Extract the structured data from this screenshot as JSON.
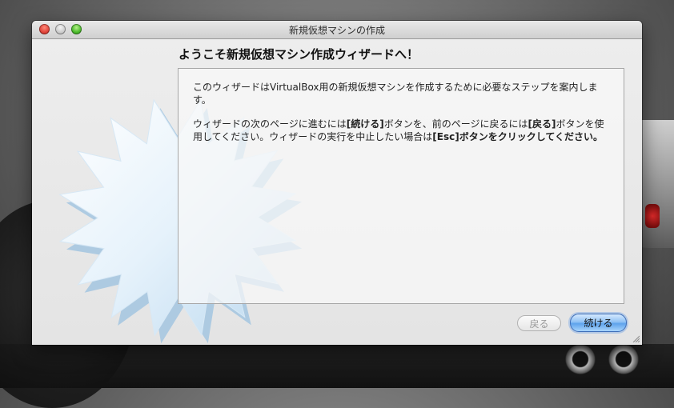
{
  "window": {
    "title": "新規仮想マシンの作成"
  },
  "wizard": {
    "heading": "ようこそ新規仮想マシン作成ウィザードへ！",
    "paragraph1": "このウィザードはVirtualBox用の新規仮想マシンを作成するために必要なステップを案内します。",
    "paragraph2_parts": {
      "a": "ウィザードの次のページに進むには",
      "b": "[続ける]",
      "c": "ボタンを、前のページに戻るには",
      "d": "[戻る]",
      "e": "ボタンを使用してください。ウィザードの実行を中止したい場合は",
      "f": "[Esc]ボタンをクリックしてください。"
    }
  },
  "buttons": {
    "back_label": "戻る",
    "back_enabled": false,
    "next_label": "続ける"
  },
  "colors": {
    "accent": "#5ea3ec",
    "close": "#e0443a",
    "zoom": "#49b92a"
  },
  "icons": {
    "window_controls": [
      "close-icon",
      "minimize-icon",
      "zoom-icon"
    ],
    "decoration": "starburst-icon"
  }
}
